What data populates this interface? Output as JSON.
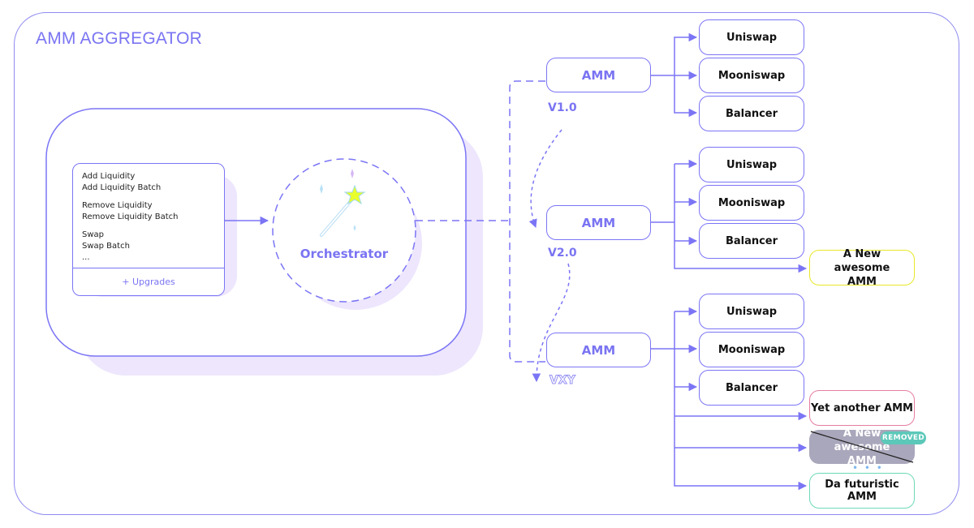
{
  "title": "AMM AGGREGATOR",
  "colors": {
    "accent": "#7a74f2",
    "shadow": "#ede6fd",
    "new_amm_border": "#e8e829",
    "yet_another_border": "#e57da0",
    "removed_fill": "#a9a7bb",
    "removed_badge": "#5cc8b9",
    "futuristic_border": "#6dd9b8"
  },
  "operations_panel": {
    "groups": [
      [
        "Add Liquidity",
        "Add Liquidity Batch"
      ],
      [
        "Remove Liquidity",
        "Remove Liquidity Batch"
      ],
      [
        "Swap",
        "Swap Batch",
        "..."
      ]
    ],
    "footer": "+ Upgrades"
  },
  "orchestrator": {
    "label": "Orchestrator",
    "icon": "magic-wand-icon"
  },
  "versions": [
    {
      "amm_label": "AMM",
      "version": "V1.0",
      "targets": [
        {
          "label": "Uniswap"
        },
        {
          "label": "Mooniswap"
        },
        {
          "label": "Balancer"
        }
      ]
    },
    {
      "amm_label": "AMM",
      "version": "V2.0",
      "targets": [
        {
          "label": "Uniswap"
        },
        {
          "label": "Mooniswap"
        },
        {
          "label": "Balancer"
        },
        {
          "label": "A New awesome AMM",
          "status": "new"
        }
      ]
    },
    {
      "amm_label": "AMM",
      "version": "VXY",
      "targets": [
        {
          "label": "Uniswap"
        },
        {
          "label": "Mooniswap"
        },
        {
          "label": "Balancer"
        },
        {
          "label": "Yet another AMM",
          "status": "new"
        },
        {
          "label": "A New awesome AMM",
          "status": "removed"
        },
        {
          "label": "Da futuristic AMM",
          "status": "future"
        }
      ]
    }
  ],
  "removed_badge": "REMOVED",
  "ellipsis": "• • •"
}
